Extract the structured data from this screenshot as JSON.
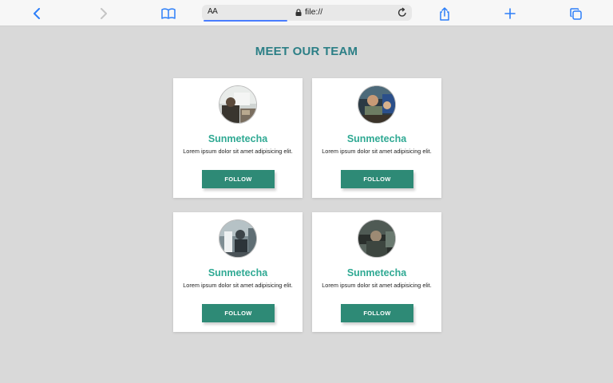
{
  "browser": {
    "text_size_label": "AA",
    "url": "file://",
    "icons": [
      "back-icon",
      "forward-icon",
      "bookmarks-icon",
      "lock-icon",
      "reload-icon",
      "share-icon",
      "new-tab-icon",
      "tabs-icon"
    ]
  },
  "page": {
    "title": "MEET OUR TEAM"
  },
  "team": [
    {
      "name": "Sunmetecha",
      "description": "Lorem ipsum dolor sit amet adipisicing elit.",
      "button": "FOLLOW"
    },
    {
      "name": "Sunmetecha",
      "description": "Lorem ipsum dolor sit amet adipisicing elit.",
      "button": "FOLLOW"
    },
    {
      "name": "Sunmetecha",
      "description": "Lorem ipsum dolor sit amet adipisicing elit.",
      "button": "FOLLOW"
    },
    {
      "name": "Sunmetecha",
      "description": "Lorem ipsum dolor sit amet adipisicing elit.",
      "button": "FOLLOW"
    }
  ],
  "colors": {
    "background": "#d9d9d9",
    "title": "#2c7f86",
    "name": "#2fa993",
    "button": "#2e8a76",
    "browser_accent": "#4a7dff"
  }
}
